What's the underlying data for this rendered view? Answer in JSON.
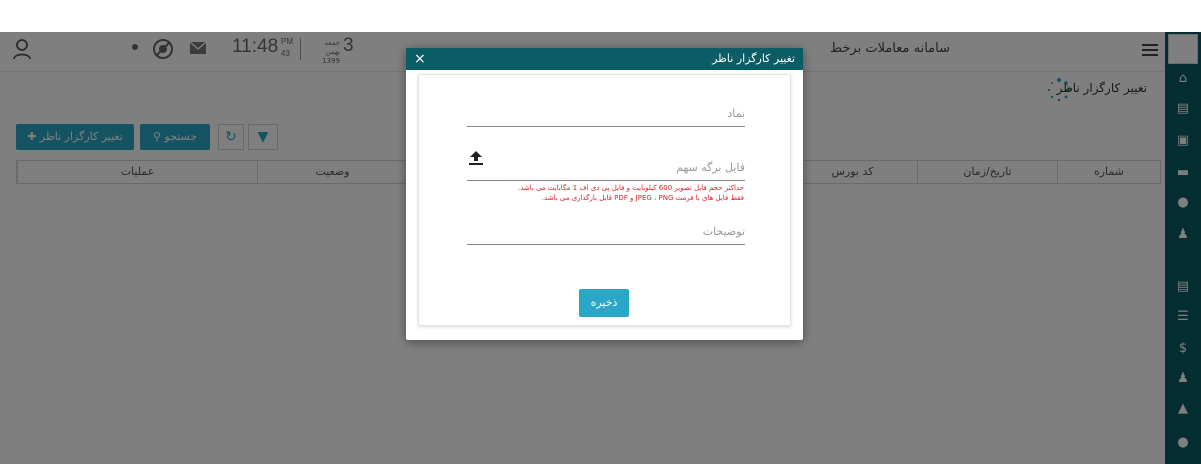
{
  "header": {
    "app_title": "سامانه معاملات برخط",
    "time": "11:48",
    "ampm": "PM",
    "seconds": "43",
    "weekday": "جمعه",
    "month_year": "بهمن 1399",
    "day": "3"
  },
  "page": {
    "title": "تغییر کارگزار ناظر"
  },
  "toolbar": {
    "change_broker_label": "تغییر کارگزار ناظر",
    "search_label": "جستجو"
  },
  "table": {
    "columns": [
      "شماره",
      "تاریخ/زمان",
      "کد بورس",
      "وضعیت",
      "عملیات"
    ]
  },
  "modal": {
    "title": "تغییر کارگزار ناظر",
    "close_label": "×",
    "symbol_placeholder": "نماد",
    "file_label": "فایل برگه سهم",
    "error_line1": "حداکثر حجم فایل تصویر 600 کیلوبایت و فایل پی دی اف 1 مگابایت می باشد.",
    "error_line2": "فقط فایل های با فرمت JPEG ، PNG و PDF قابل بارگذاری می باشد.",
    "description_placeholder": "توضیحات",
    "save_label": "ذخیره"
  },
  "nav": {
    "icons": [
      "home-icon",
      "list-icon",
      "document-icon",
      "briefcase-icon",
      "chart-icon",
      "users-icon",
      "card-icon",
      "table-icon",
      "dollar-icon",
      "add-user-icon",
      "bell-icon",
      "help-icon"
    ]
  },
  "colors": {
    "primary_dark": "#0a5d65",
    "accent": "#2aa6c6",
    "error": "#d9232a"
  }
}
